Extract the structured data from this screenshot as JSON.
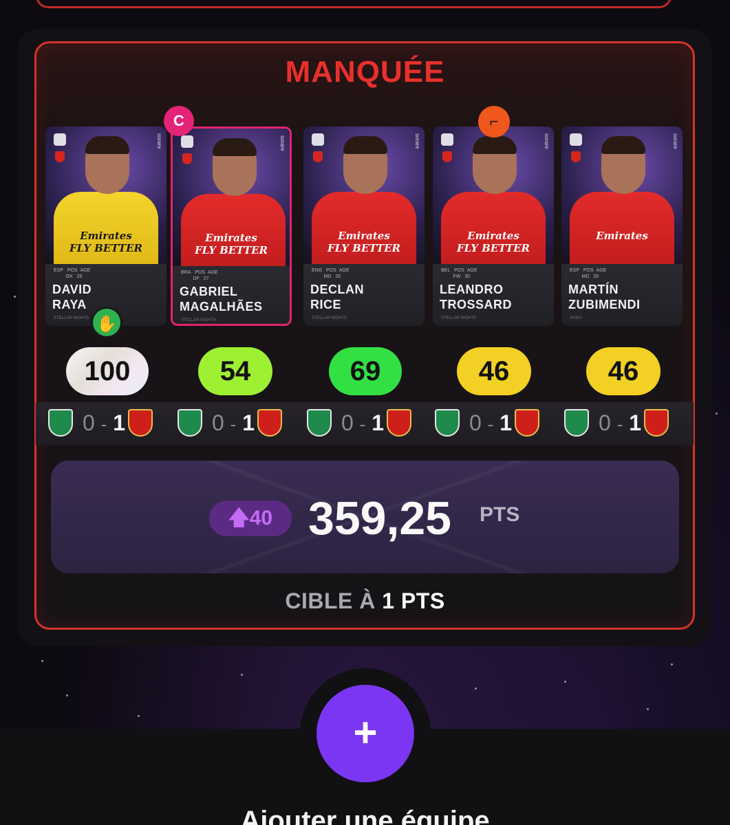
{
  "title": "MANQUÉE",
  "players": [
    {
      "first": "DAVID",
      "last": "RAYA",
      "nat": "ESP",
      "pos": "GK",
      "age": "29",
      "score": "100",
      "tier": "white",
      "kit": "yellow",
      "sponsor1": "Emirates",
      "sponsor2": "FLY BETTER",
      "edition": "STELLAR NIGHTS"
    },
    {
      "first": "GABRIEL",
      "last": "MAGALHÃES",
      "nat": "BRA",
      "pos": "DF",
      "age": "27",
      "score": "54",
      "tier": "lime",
      "kit": "red",
      "sponsor1": "Emirates",
      "sponsor2": "FLY BETTER",
      "edition": "STELLAR NIGHTS"
    },
    {
      "first": "DECLAN",
      "last": "RICE",
      "nat": "ENG",
      "pos": "MD",
      "age": "26",
      "score": "69",
      "tier": "green",
      "kit": "red",
      "sponsor1": "Emirates",
      "sponsor2": "FLY BETTER",
      "edition": "STELLAR NIGHTS"
    },
    {
      "first": "LEANDRO",
      "last": "TROSSARD",
      "nat": "BEL",
      "pos": "FW",
      "age": "30",
      "score": "46",
      "tier": "yellow",
      "kit": "red",
      "sponsor1": "Emirates",
      "sponsor2": "FLY BETTER",
      "edition": "STELLAR NIGHTS"
    },
    {
      "first": "MARTÍN",
      "last": "ZUBIMENDI",
      "nat": "ESP",
      "pos": "MD",
      "age": "26",
      "score": "46",
      "tier": "yellow",
      "kit": "red",
      "sponsor1": "Emirates",
      "sponsor2": "",
      "edition": "SHINY"
    }
  ],
  "meta_labels": {
    "pos": "POS",
    "age": "AGE"
  },
  "brand": "sorare",
  "captain_badge": "C",
  "match": {
    "home_score": "0",
    "dash": "-",
    "away_score": "1",
    "home_team": "Sporting CP",
    "away_team": "Arsenal"
  },
  "boost": {
    "arrow": "🡅",
    "value": "40"
  },
  "total": {
    "value": "359,25",
    "unit": "PTS"
  },
  "target": {
    "prefix": "CIBLE À",
    "strong": "1 PTS"
  },
  "fab": {
    "label": "+"
  },
  "add_team": "Ajouter une équipe",
  "icons": {
    "captain": "captain-icon",
    "glove": "goalkeeper-glove-icon",
    "boost": "arrow-up-icon",
    "fab": "plus-icon"
  },
  "colors": {
    "accent_red": "#e8302b",
    "captain": "#e52377",
    "fab": "#7a36f2",
    "boost_text": "#c36cf6"
  }
}
